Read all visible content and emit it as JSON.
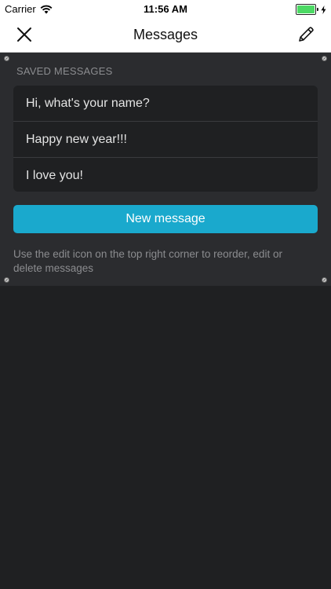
{
  "status_bar": {
    "carrier": "Carrier",
    "time": "11:56 AM",
    "battery_level": 1.0
  },
  "nav": {
    "title": "Messages",
    "left_icon": "close-icon",
    "right_icon": "pencil-icon"
  },
  "saved": {
    "section_title": "SAVED MESSAGES",
    "messages": [
      "Hi, what's your name?",
      "Happy new year!!!",
      "I love you!"
    ]
  },
  "actions": {
    "new_message_label": "New message"
  },
  "hint": "Use the edit icon on the top right corner to reorder, edit or delete messages",
  "colors": {
    "background": "#1f2022",
    "panel": "#2b2c2f",
    "accent": "#1aa9cd",
    "battery": "#4cd964"
  }
}
